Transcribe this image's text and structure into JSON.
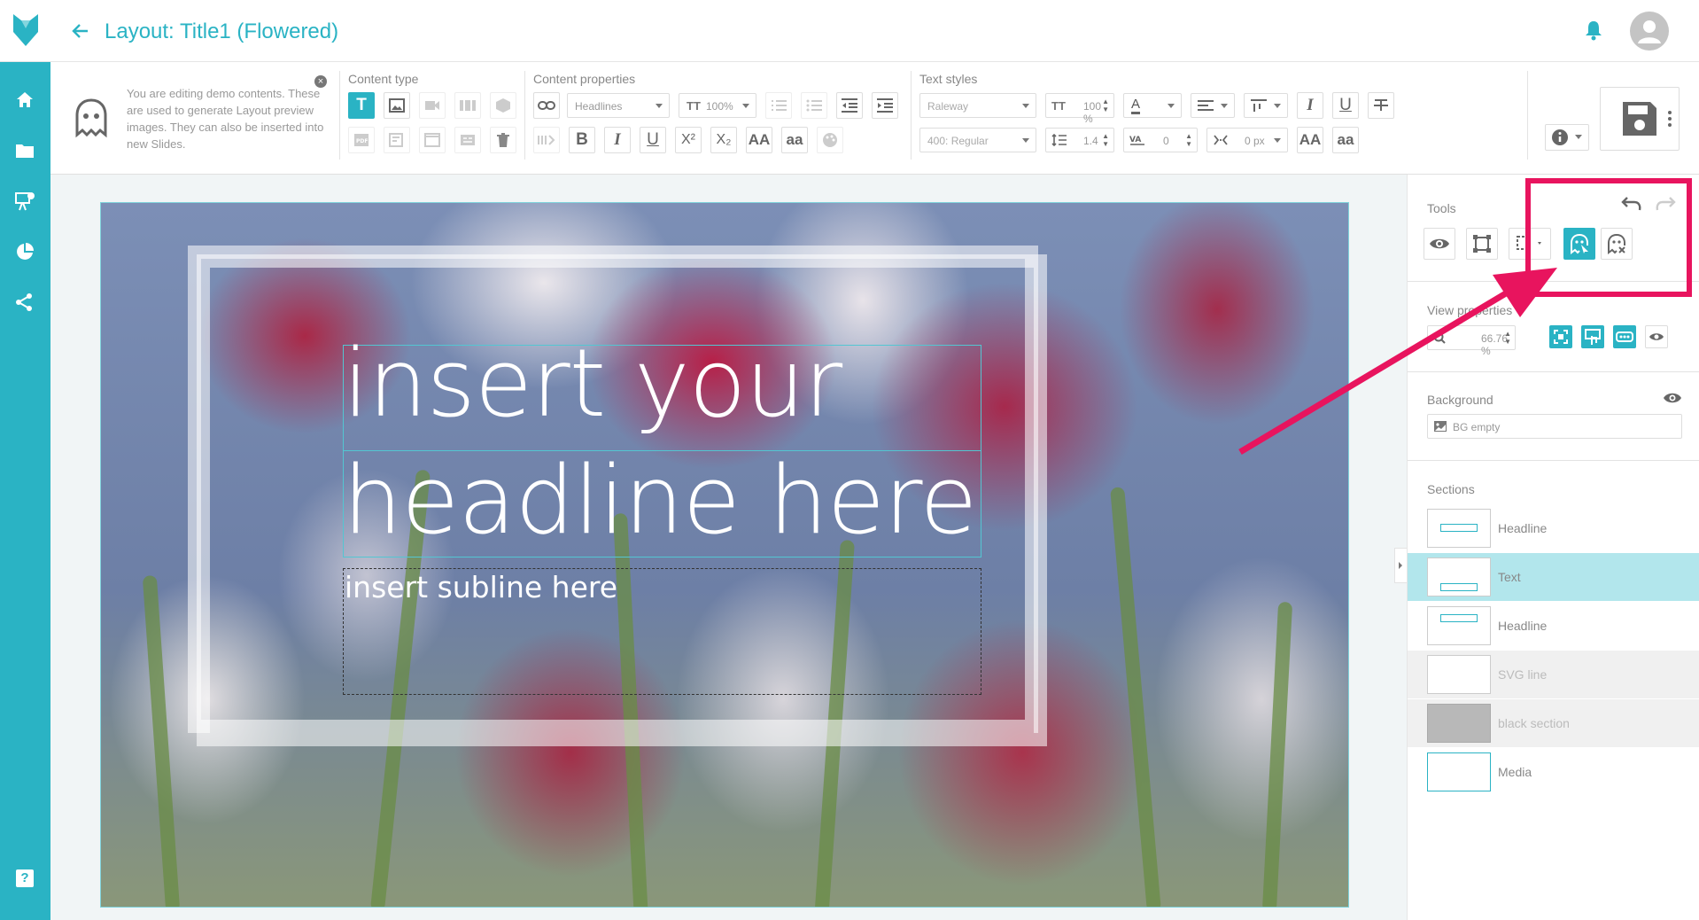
{
  "header": {
    "title": "Layout: Title1 (Flowered)",
    "back_icon": "arrow-left-icon",
    "notification_icon": "bell-icon",
    "avatar_icon": "user-avatar-icon"
  },
  "sidebar": {
    "items": [
      {
        "icon": "home-icon"
      },
      {
        "icon": "folder-icon"
      },
      {
        "icon": "presentation-icon"
      },
      {
        "icon": "chart-icon"
      },
      {
        "icon": "share-icon"
      },
      {
        "icon": "help-icon",
        "label": "?"
      }
    ]
  },
  "demo_notice": {
    "text": "You are editing demo contents. These are used to generate Layout preview images. They can also be inserted into new Slides."
  },
  "toolbar": {
    "content_type_label": "Content type",
    "content_properties_label": "Content properties",
    "text_styles_label": "Text styles",
    "content_property_select": "Headlines",
    "font_size_percent": "100%",
    "bold": "B",
    "italic": "I",
    "underline": "U",
    "superscript": "X²",
    "subscript": "X₂",
    "uppercase": "AA",
    "lowercase": "aa",
    "font_family": "Raleway",
    "font_weight": "400: Regular",
    "text_size": "100 %",
    "line_height": "1.4",
    "letter_spacing": "0",
    "word_spacing": "0 px",
    "color_letter": "A",
    "type_icon": "T"
  },
  "right_panel": {
    "tools_label": "Tools",
    "view_properties_label": "View properties",
    "zoom_value": "66.76 %",
    "background_label": "Background",
    "background_value": "BG empty",
    "sections_label": "Sections",
    "sections": [
      {
        "name": "Headline",
        "state": "normal"
      },
      {
        "name": "Text",
        "state": "selected"
      },
      {
        "name": "Headline",
        "state": "normal"
      },
      {
        "name": "SVG line",
        "state": "disabled"
      },
      {
        "name": "black section",
        "state": "disabled"
      },
      {
        "name": "Media",
        "state": "normal"
      }
    ]
  },
  "slide": {
    "headline_line1": "insert your",
    "headline_line2": "headline here",
    "subline": "insert subline here"
  },
  "annotation": {
    "color": "#e8145e"
  },
  "colors": {
    "accent": "#2ab3c4",
    "selected_row": "#b2e6ec"
  }
}
